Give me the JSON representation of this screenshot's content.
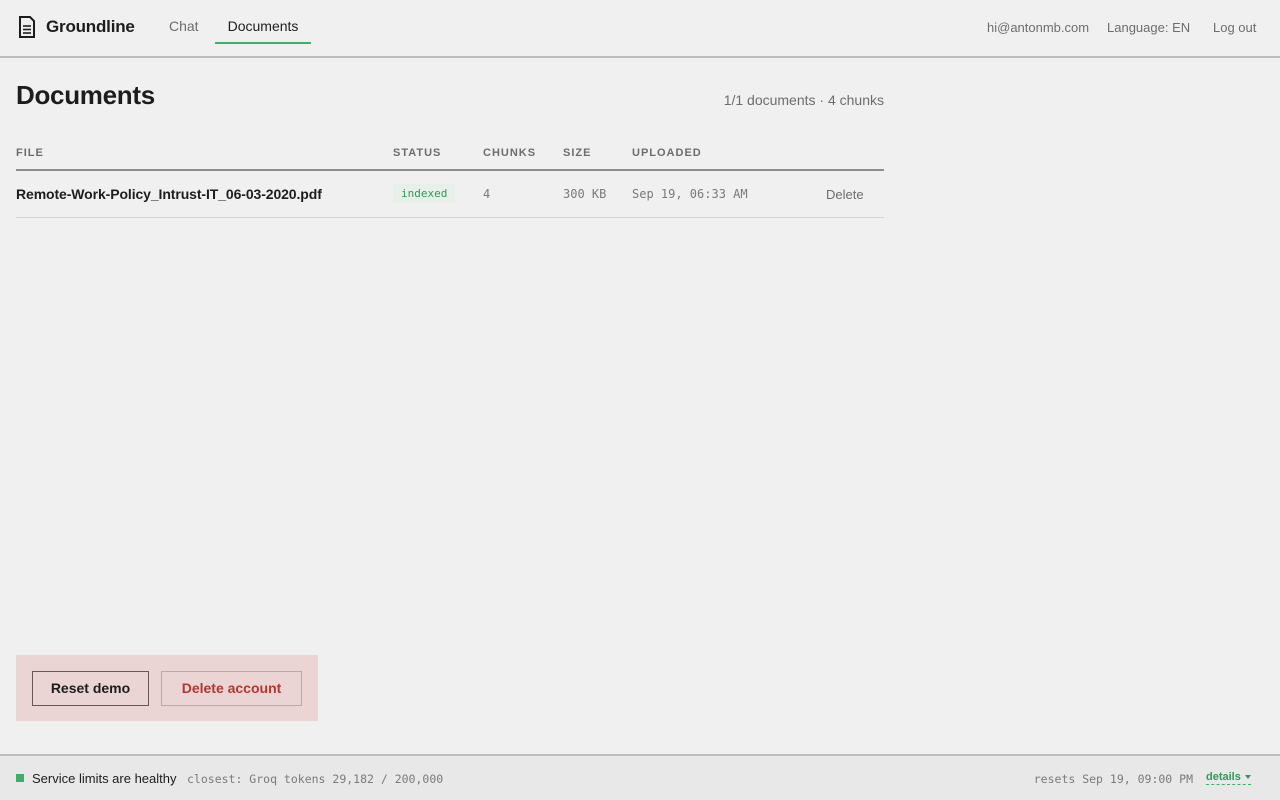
{
  "header": {
    "brand": "Groundline",
    "tabs": [
      {
        "label": "Chat",
        "active": false
      },
      {
        "label": "Documents",
        "active": true
      }
    ],
    "email": "hi@antonmb.com",
    "language": "Language: EN",
    "logout": "Log out"
  },
  "page": {
    "title": "Documents",
    "summary": "1/1 documents · 4 chunks"
  },
  "table": {
    "columns": [
      "FILE",
      "STATUS",
      "CHUNKS",
      "SIZE",
      "UPLOADED"
    ],
    "rows": [
      {
        "file": "Remote-Work-Policy_Intrust-IT_06-03-2020.pdf",
        "status": "indexed",
        "chunks": "4",
        "size": "300 KB",
        "uploaded": "Sep 19, 06:33 AM",
        "action": "Delete"
      }
    ]
  },
  "danger_zone": {
    "reset_label": "Reset demo",
    "delete_label": "Delete account"
  },
  "footer": {
    "status": "Service limits are healthy",
    "closest": "closest: Groq tokens 29,182 / 200,000",
    "resets": "resets Sep 19, 09:00 PM",
    "details": "details"
  },
  "colors": {
    "accent": "#3fae6a",
    "danger": "#b2372f",
    "danger_zone_bg": "#ebd4d4",
    "background": "#f0f0f0"
  },
  "icons": {
    "brand": "document-icon",
    "details": "caret-down-icon"
  }
}
